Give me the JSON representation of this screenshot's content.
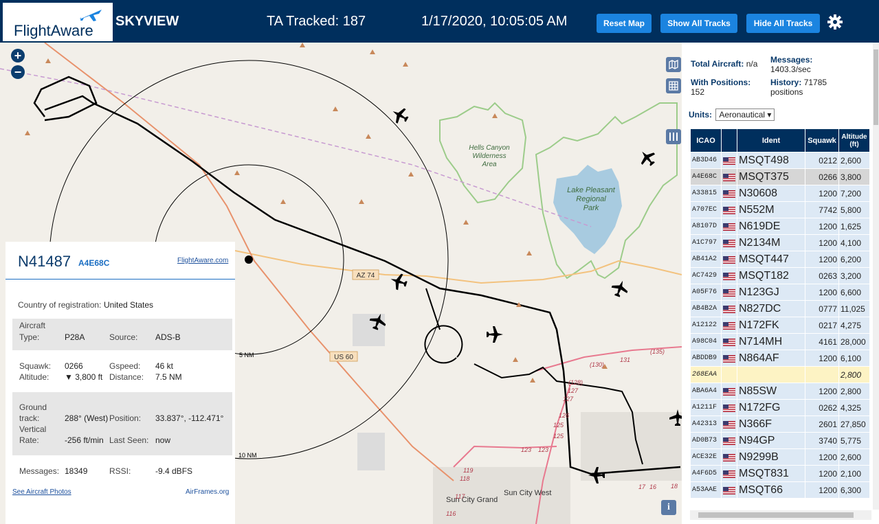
{
  "header": {
    "logo_text": "FlightAware",
    "app_name": "SKYVIEW",
    "tracked": "TA Tracked: 187",
    "datetime": "1/17/2020, 10:05:05 AM",
    "buttons": {
      "reset": "Reset Map",
      "show": "Show All Tracks",
      "hide": "Hide All Tracks"
    },
    "bg_color": "#002F5D",
    "button_color": "#1b84e0"
  },
  "map": {
    "labels": {
      "hells_canyon": [
        "Hells Canyon",
        "Wilderness",
        "Area"
      ],
      "lake_pleasant": [
        "Lake Pleasant",
        "Regional",
        "Park"
      ],
      "az74": "AZ 74",
      "us60": "US 60",
      "nm5": "5 NM",
      "nm10": "10 NM",
      "sun_city_grand": "Sun City Grand",
      "sun_city_west": "Sun City West",
      "r130": "(130)",
      "r131": "131",
      "r135": "(135)",
      "r128": "(128)",
      "r127a": "127",
      "r127b": "127",
      "r126": "126",
      "r125a": "125",
      "r125b": "125",
      "r123a": "123",
      "r123b": "123",
      "r119": "119",
      "r118": "118",
      "r117": "117",
      "r116": "116",
      "r17": "17",
      "r16": "16",
      "r18": "18"
    },
    "info_button": "i"
  },
  "selected": {
    "registration": "N41487",
    "hex": "A4E68C",
    "flightaware_link": "FlightAware.com",
    "country_label": "Country of registration:",
    "country": "United States",
    "aircraft_type_label": [
      "Aircraft",
      "Type:"
    ],
    "aircraft_type": "P28A",
    "source_label": "Source:",
    "source": "ADS-B",
    "squawk_label": "Squawk:",
    "squawk": "0266",
    "gspeed_label": "Gspeed:",
    "gspeed": "46 kt",
    "altitude_label": "Altitude:",
    "altitude": "▼ 3,800 ft",
    "distance_label": "Distance:",
    "distance": "7.5 NM",
    "ground_track_label": [
      "Ground",
      "track:"
    ],
    "ground_track": "288° (West)",
    "position_label": "Position:",
    "position": "33.837°, -112.471°",
    "vrate_label": [
      "Vertical",
      "Rate:"
    ],
    "vrate": "-256 ft/min",
    "last_seen_label": "Last Seen:",
    "last_seen": "now",
    "messages_label": "Messages:",
    "messages": "18349",
    "rssi_label": "RSSI:",
    "rssi": "-9.4 dBFS",
    "photos_link": "See Aircraft Photos",
    "airframes_link": "AirFrames.org"
  },
  "stats": {
    "total_label": "Total Aircraft:",
    "total": "n/a",
    "messages_label": "Messages:",
    "messages": "1403.3/sec",
    "positions_label": "With Positions:",
    "positions": "152",
    "history_label": "History:",
    "history": "71785",
    "history_unit": "positions",
    "units_label": "Units:",
    "units_selected": "Aeronautical"
  },
  "table": {
    "headers": [
      "ICAO",
      "",
      "Ident",
      "Squawk",
      "Altitude (ft)"
    ],
    "rows": [
      {
        "icao": "AB3D46",
        "ident": "MSQT498",
        "squawk": "0212",
        "alt": "2,600"
      },
      {
        "icao": "A4E68C",
        "ident": "MSQT375",
        "squawk": "0266",
        "alt": "3,800"
      },
      {
        "icao": "A33815",
        "ident": "N30608",
        "squawk": "1200",
        "alt": "7,200"
      },
      {
        "icao": "A707EC",
        "ident": "N552M",
        "squawk": "7742",
        "alt": "5,800"
      },
      {
        "icao": "A8107D",
        "ident": "N619DE",
        "squawk": "1200",
        "alt": "1,625"
      },
      {
        "icao": "A1C797",
        "ident": "N2134M",
        "squawk": "1200",
        "alt": "4,100"
      },
      {
        "icao": "AB41A2",
        "ident": "MSQT447",
        "squawk": "1200",
        "alt": "6,200"
      },
      {
        "icao": "AC7429",
        "ident": "MSQT182",
        "squawk": "0263",
        "alt": "3,200"
      },
      {
        "icao": "A05F76",
        "ident": "N123GJ",
        "squawk": "1200",
        "alt": "6,600"
      },
      {
        "icao": "AB4B2A",
        "ident": "N827DC",
        "squawk": "0777",
        "alt": "11,025"
      },
      {
        "icao": "A12122",
        "ident": "N172FK",
        "squawk": "0217",
        "alt": "4,275"
      },
      {
        "icao": "A98C04",
        "ident": "N714MH",
        "squawk": "4161",
        "alt": "28,000"
      },
      {
        "icao": "ABDDB9",
        "ident": "N864AF",
        "squawk": "1200",
        "alt": "6,100"
      },
      {
        "icao": "268EAA",
        "ident": "",
        "squawk": "",
        "alt": "2,800"
      },
      {
        "icao": "ABA6A4",
        "ident": "N85SW",
        "squawk": "1200",
        "alt": "2,800"
      },
      {
        "icao": "A1211F",
        "ident": "N172FG",
        "squawk": "0262",
        "alt": "4,325"
      },
      {
        "icao": "A42313",
        "ident": "N366F",
        "squawk": "2601",
        "alt": "27,850"
      },
      {
        "icao": "AD0B73",
        "ident": "N94GP",
        "squawk": "3740",
        "alt": "5,775"
      },
      {
        "icao": "ACE32E",
        "ident": "N9299B",
        "squawk": "1200",
        "alt": "2,600"
      },
      {
        "icao": "A4F6D5",
        "ident": "MSQT831",
        "squawk": "1200",
        "alt": "2,100"
      },
      {
        "icao": "A53AAE",
        "ident": "MSQT66",
        "squawk": "1200",
        "alt": "6,300"
      }
    ]
  }
}
